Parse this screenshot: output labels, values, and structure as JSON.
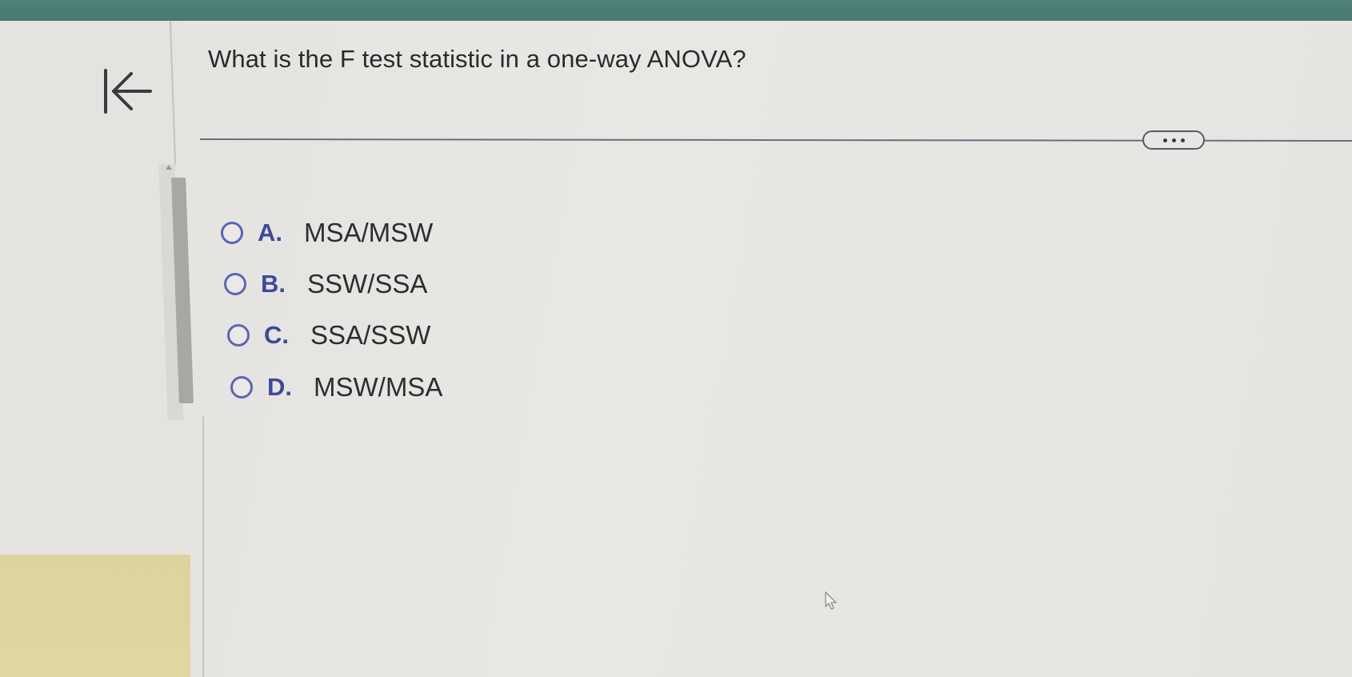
{
  "question": {
    "text": "What is the F test statistic in a one-way ANOVA?"
  },
  "navigation": {
    "back_icon": "back-to-start-icon"
  },
  "more_button": {
    "icon": "ellipsis-icon"
  },
  "options": [
    {
      "letter": "A.",
      "text": "MSA/MSW"
    },
    {
      "letter": "B.",
      "text": "SSW/SSA"
    },
    {
      "letter": "C.",
      "text": "SSA/SSW"
    },
    {
      "letter": "D.",
      "text": "MSW/MSA"
    }
  ],
  "colors": {
    "top_bar": "#4d8077",
    "radio_accent": "#5a66b8",
    "option_letter": "#3c4a9c",
    "left_yellow": "#ddd39e"
  }
}
